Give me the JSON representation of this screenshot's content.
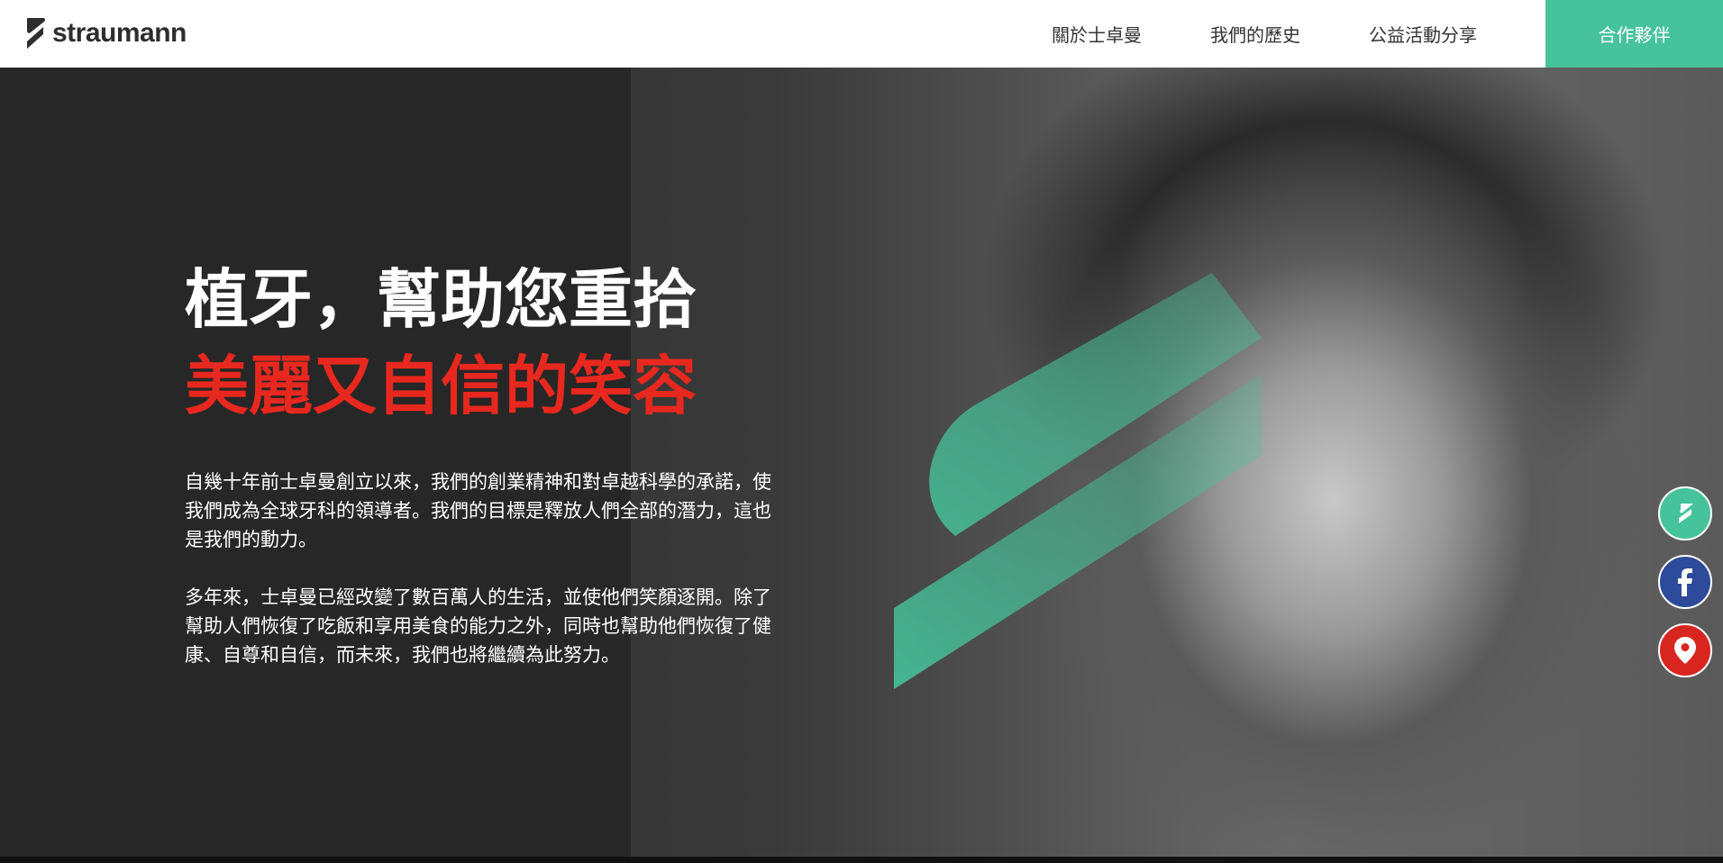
{
  "header": {
    "logo_text": "straumann",
    "nav": [
      "關於士卓曼",
      "我們的歷史",
      "公益活動分享"
    ],
    "cta": "合作夥伴"
  },
  "hero": {
    "headline_line1": "植牙，幫助您重拾",
    "headline_line2": "美麗又自信的笑容",
    "paragraph1": "自幾十年前士卓曼創立以來，我們的創業精神和對卓越科學的承諾，使我們成為全球牙科的領導者。我們的目標是釋放人們全部的潛力，這也是我們的動力。",
    "paragraph2": "多年來，士卓曼已經改變了數百萬人的生活，並使他們笑顏逐開。除了幫助人們恢復了吃飯和享用美食的能力之外，同時也幫助他們恢復了健康、自尊和自信，而未來，我們也將繼續為此努力。"
  },
  "social": {
    "items": [
      {
        "icon": "straumann-icon",
        "color": "#46c39a"
      },
      {
        "icon": "facebook-icon",
        "color": "#2e4a9a"
      },
      {
        "icon": "map-pin-icon",
        "color": "#d8261e"
      }
    ]
  },
  "colors": {
    "accent_green": "#46c39a",
    "headline_red": "#e8281e",
    "hero_bg": "#272727"
  }
}
